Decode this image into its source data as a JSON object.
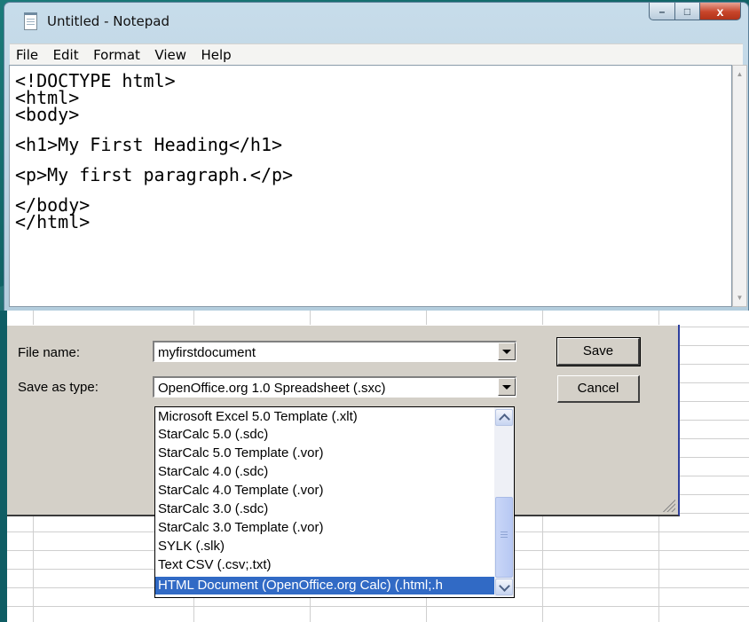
{
  "notepad": {
    "title": "Untitled - Notepad",
    "menu": [
      "File",
      "Edit",
      "Format",
      "View",
      "Help"
    ],
    "code_lines": [
      "<!DOCTYPE html>",
      "<html>",
      "<body>",
      "",
      "<h1>My First Heading</h1>",
      "",
      "<p>My first paragraph.</p>",
      "",
      "</body>",
      "</html>"
    ],
    "controls": {
      "minimize": "–",
      "maximize": "□",
      "close": "x"
    }
  },
  "save_dialog": {
    "file_name_label": "File name:",
    "file_name_value": "myfirstdocument",
    "save_as_type_label": "Save as type:",
    "save_as_type_value": "OpenOffice.org 1.0 Spreadsheet (.sxc)",
    "save_button": "Save",
    "cancel_button": "Cancel",
    "type_options": [
      "Microsoft Excel 5.0 Template (.xlt)",
      "StarCalc 5.0 (.sdc)",
      "StarCalc 5.0 Template (.vor)",
      "StarCalc 4.0 (.sdc)",
      "StarCalc 4.0 Template (.vor)",
      "StarCalc 3.0 (.sdc)",
      "StarCalc 3.0 Template (.vor)",
      "SYLK (.slk)",
      "Text CSV (.csv;.txt)",
      "HTML Document (OpenOffice.org Calc) (.html;.h"
    ],
    "selected_option_index": 9
  },
  "colors": {
    "selection": "#316ac5",
    "dialog_face": "#d4d0c8",
    "desktop": "#0d5f63"
  }
}
